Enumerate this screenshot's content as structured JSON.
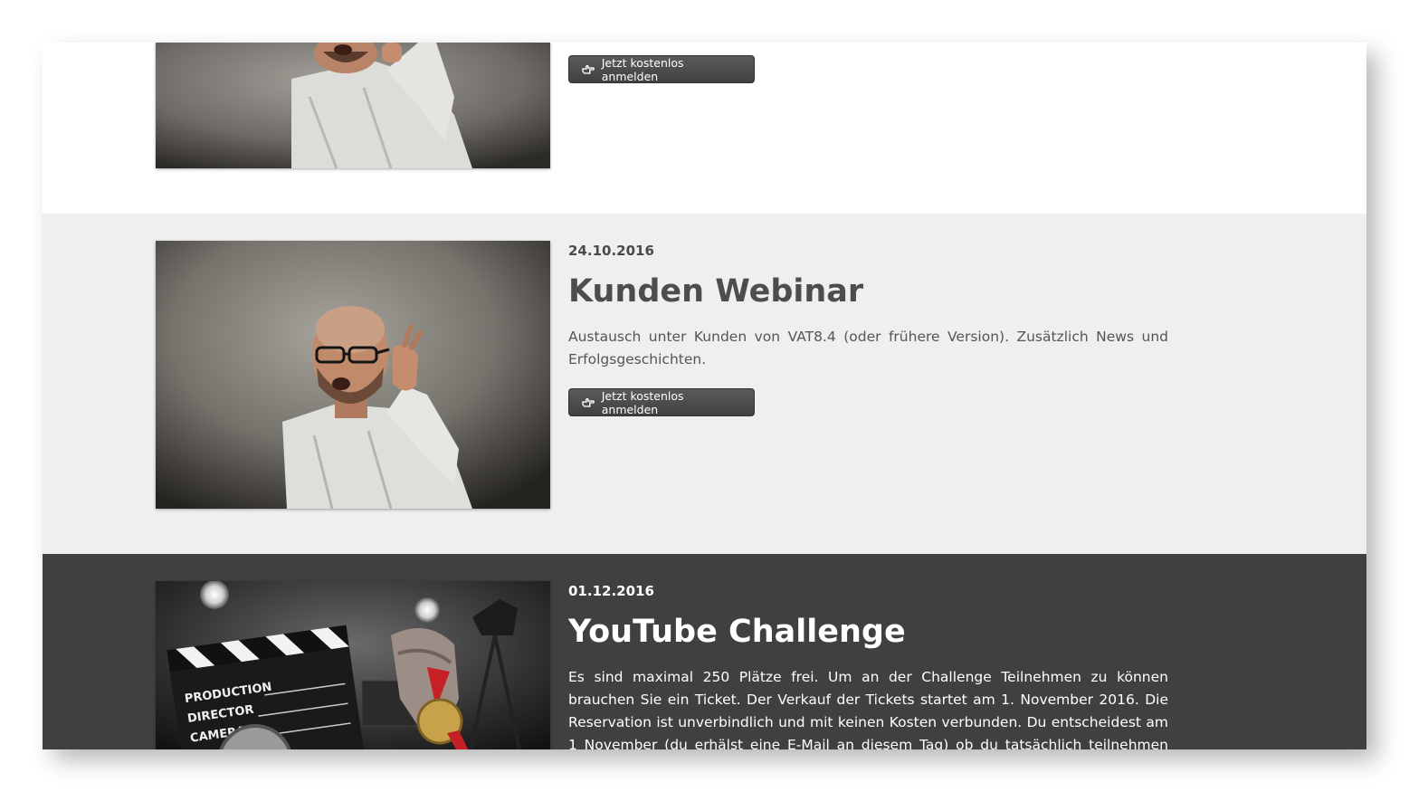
{
  "events": [
    {
      "button_label": "Jetzt kostenlos anmelden",
      "button_icon": "hand-point-right-icon"
    },
    {
      "date": "24.10.2016",
      "title": "Kunden Webinar",
      "description": "Austausch unter Kunden von VAT8.4 (oder frühere Version). Zusätzlich News und Erfolgsgeschichten.",
      "button_label": "Jetzt kostenlos anmelden",
      "button_icon": "hand-point-right-icon"
    },
    {
      "date": "01.12.2016",
      "title": "YouTube Challenge",
      "description": "Es sind maximal 250 Plätze frei. Um an der Challenge Teilnehmen zu können brauchen Sie ein Ticket. Der Verkauf der Tickets startet am 1. November 2016. Die Reservation ist unverbindlich und mit keinen Kosten verbunden. Du entscheidest am 1 November (du erhälst eine E-Mail an diesem Tag) ob du tatsächlich teilnehmen möchtest.",
      "clapperboard_lines": [
        "PRODUCTION",
        "DIRECTOR",
        "CAMERA"
      ]
    }
  ],
  "colors": {
    "section_light": "#efefef",
    "section_dark": "#404040",
    "button_bg": "#4a4a4a"
  }
}
